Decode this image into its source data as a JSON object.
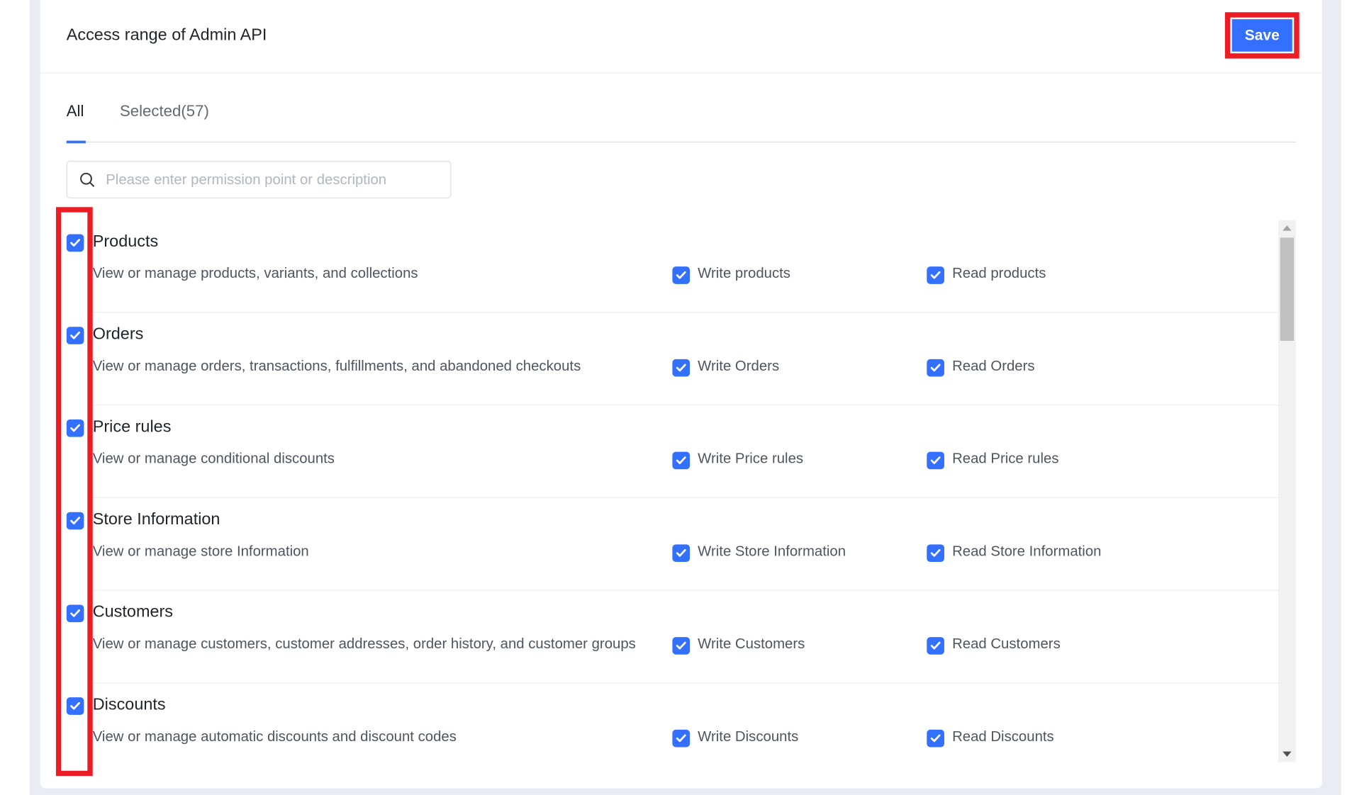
{
  "header": {
    "title": "Access range of Admin API",
    "save_label": "Save"
  },
  "tabs": [
    {
      "label": "All",
      "active": true
    },
    {
      "label": "Selected(57)",
      "active": false
    }
  ],
  "search": {
    "placeholder": "Please enter permission point or description",
    "value": ""
  },
  "colors": {
    "accent": "#3370ff",
    "highlight": "#ec1c24"
  },
  "permissions": [
    {
      "title": "Products",
      "description": "View or manage products, variants, and collections",
      "checked": true,
      "write": {
        "label": "Write products",
        "checked": true
      },
      "read": {
        "label": "Read products",
        "checked": true
      }
    },
    {
      "title": "Orders",
      "description": "View or manage orders, transactions, fulfillments, and abandoned checkouts",
      "checked": true,
      "write": {
        "label": "Write Orders",
        "checked": true
      },
      "read": {
        "label": "Read Orders",
        "checked": true
      }
    },
    {
      "title": "Price rules",
      "description": "View or manage conditional discounts",
      "checked": true,
      "write": {
        "label": "Write Price rules",
        "checked": true
      },
      "read": {
        "label": "Read Price rules",
        "checked": true
      }
    },
    {
      "title": "Store Information",
      "description": "View or manage store Information",
      "checked": true,
      "write": {
        "label": "Write Store Information",
        "checked": true
      },
      "read": {
        "label": "Read Store Information",
        "checked": true
      }
    },
    {
      "title": "Customers",
      "description": "View or manage customers, customer addresses, order history, and customer groups",
      "checked": true,
      "write": {
        "label": "Write Customers",
        "checked": true
      },
      "read": {
        "label": "Read Customers",
        "checked": true
      }
    },
    {
      "title": "Discounts",
      "description": "View or manage automatic discounts and discount codes",
      "checked": true,
      "write": {
        "label": "Write Discounts",
        "checked": true
      },
      "read": {
        "label": "Read Discounts",
        "checked": true
      }
    }
  ]
}
